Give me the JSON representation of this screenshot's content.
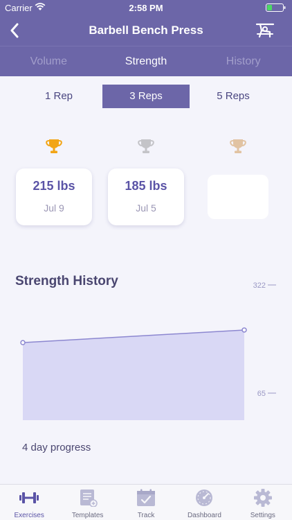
{
  "status_bar": {
    "carrier": "Carrier",
    "time": "2:58 PM"
  },
  "nav": {
    "title": "Barbell Bench Press",
    "back_icon": "chevron-left-icon",
    "right_icon": "bench-press-icon"
  },
  "tabs": [
    {
      "label": "Volume",
      "active": false
    },
    {
      "label": "Strength",
      "active": true
    },
    {
      "label": "History",
      "active": false
    }
  ],
  "reps": [
    {
      "label": "1 Rep",
      "active": false
    },
    {
      "label": "3 Reps",
      "active": true
    },
    {
      "label": "5 Reps",
      "active": false
    }
  ],
  "records": [
    {
      "trophy": "gold-trophy-icon",
      "weight": "215 lbs",
      "date": "Jul 9"
    },
    {
      "trophy": "silver-trophy-icon",
      "weight": "185 lbs",
      "date": "Jul 5"
    },
    {
      "trophy": "bronze-trophy-icon",
      "weight": "",
      "date": ""
    }
  ],
  "strength_history": {
    "title": "Strength History",
    "progress_label": "4 day progress"
  },
  "chart_data": {
    "type": "area",
    "title": "Strength History",
    "x": [
      0,
      1
    ],
    "series": [
      {
        "values": [
          185,
          215
        ]
      }
    ],
    "ylim": [
      65,
      322
    ],
    "yticks": [
      "322",
      "65"
    ],
    "ytick_values": [
      322,
      65
    ],
    "color": "#8c87d0"
  },
  "tabbar": [
    {
      "label": "Exercises",
      "icon": "barbell-icon",
      "active": true
    },
    {
      "label": "Templates",
      "icon": "templates-icon",
      "active": false
    },
    {
      "label": "Track",
      "icon": "calendar-check-icon",
      "active": false
    },
    {
      "label": "Dashboard",
      "icon": "gauge-icon",
      "active": false
    },
    {
      "label": "Settings",
      "icon": "gear-icon",
      "active": false
    }
  ],
  "colors": {
    "brand": "#6c66a8",
    "accent": "#5a53a6",
    "background": "#f4f4fb"
  }
}
